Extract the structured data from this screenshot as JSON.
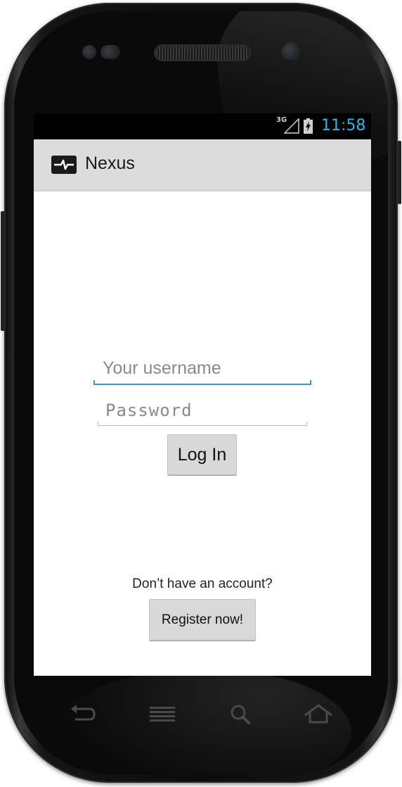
{
  "status_bar": {
    "network_type": "3G",
    "signal_icon": "signal-icon",
    "battery_icon": "battery-charging-icon",
    "time": "11:58",
    "time_color": "#33b5e5"
  },
  "action_bar": {
    "app_icon": "pulse-icon",
    "title": "Nexus",
    "background": "#dcdcdc"
  },
  "login_form": {
    "username_placeholder": "Your username",
    "username_value": "",
    "password_placeholder": "Password",
    "password_value": "",
    "login_label": "Log In",
    "focus_color": "#2e9ccd"
  },
  "register": {
    "prompt": "Don’t have an account?",
    "button_label": "Register now!"
  },
  "hardware_keys": [
    "back-icon",
    "menu-icon",
    "search-icon",
    "home-icon"
  ]
}
